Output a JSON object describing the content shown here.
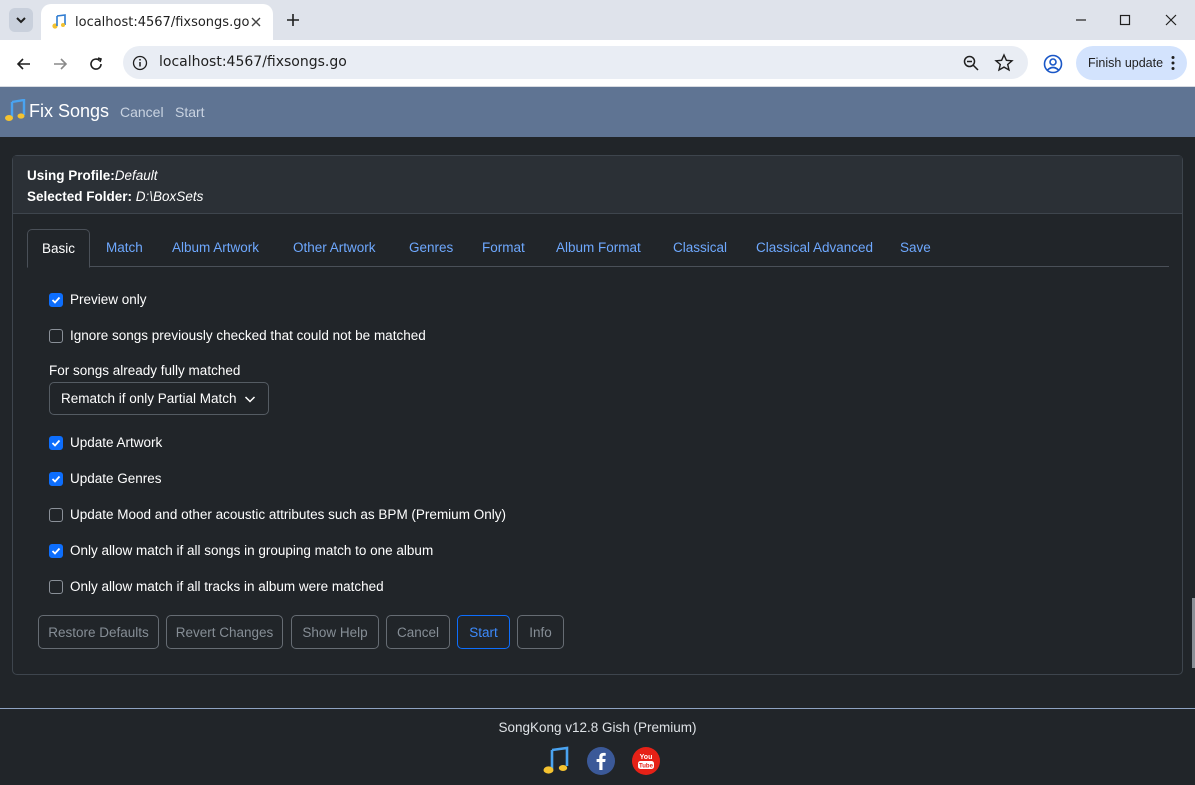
{
  "browser": {
    "tab_title": "localhost:4567/fixsongs.go",
    "url": "localhost:4567/fixsongs.go",
    "finish_update_label": "Finish update"
  },
  "app": {
    "brand": "Fix Songs",
    "nav": {
      "cancel": "Cancel",
      "start": "Start"
    }
  },
  "card": {
    "profile_label": "Using Profile:",
    "profile_value": "Default",
    "folder_label": "Selected Folder:",
    "folder_value": "D:\\BoxSets"
  },
  "tabs": [
    "Basic",
    "Match",
    "Album Artwork",
    "Other Artwork",
    "Genres",
    "Format",
    "Album Format",
    "Classical",
    "Classical Advanced",
    "Save"
  ],
  "options": {
    "preview_only": {
      "label": "Preview only",
      "checked": true
    },
    "ignore_songs": {
      "label": "Ignore songs previously checked that could not be matched",
      "checked": false
    },
    "already_matched_label": "For songs already fully matched",
    "already_matched_value": "Rematch if only Partial Match",
    "update_artwork": {
      "label": "Update Artwork",
      "checked": true
    },
    "update_genres": {
      "label": "Update Genres",
      "checked": true
    },
    "update_mood": {
      "label": "Update Mood and other acoustic attributes such as BPM (Premium Only)",
      "checked": false
    },
    "one_album": {
      "label": "Only allow match if all songs in grouping match to one album",
      "checked": true
    },
    "all_tracks": {
      "label": "Only allow match if all tracks in album were matched",
      "checked": false
    }
  },
  "buttons": {
    "restore_defaults": "Restore Defaults",
    "revert_changes": "Revert Changes",
    "show_help": "Show Help",
    "cancel": "Cancel",
    "start": "Start",
    "info": "Info"
  },
  "footer": {
    "version": "SongKong v12.8 Gish (Premium)"
  },
  "colors": {
    "accent": "#0d6efd",
    "nav_bg": "#5f7493",
    "page_bg": "#212529",
    "link": "#6ea8fe"
  }
}
